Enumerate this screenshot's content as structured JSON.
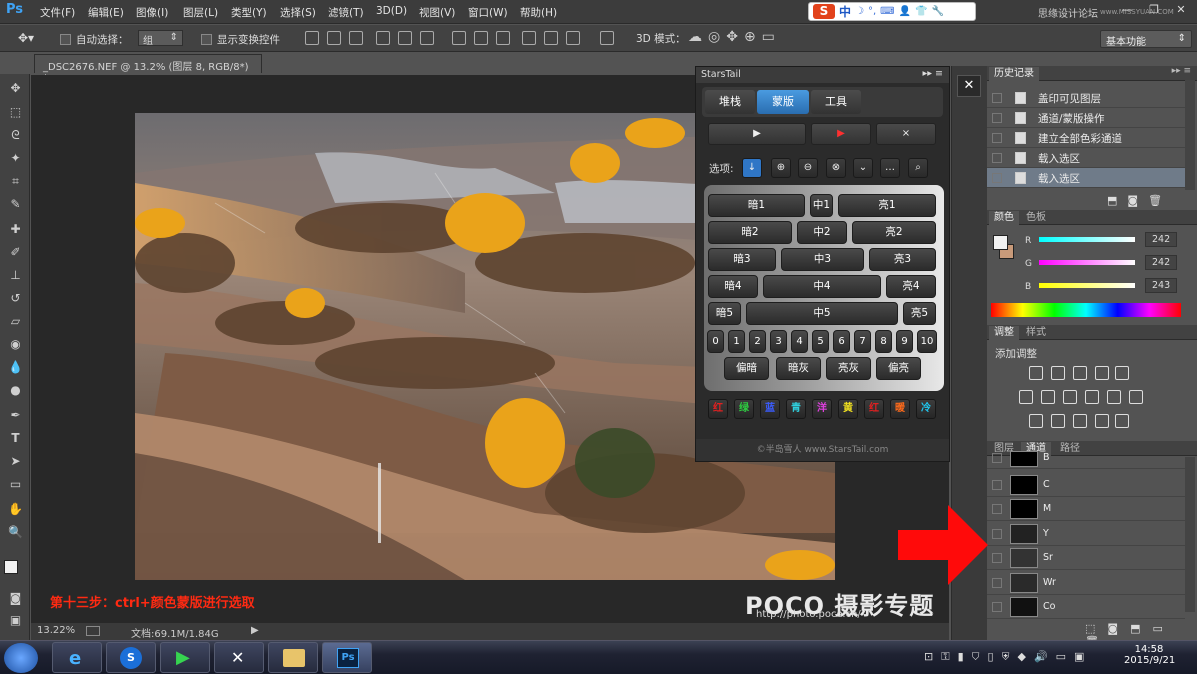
{
  "menubar": {
    "logo": "Ps",
    "items": [
      "文件(F)",
      "编辑(E)",
      "图像(I)",
      "图层(L)",
      "类型(Y)",
      "选择(S)",
      "滤镜(T)",
      "3D(D)",
      "视图(V)",
      "窗口(W)",
      "帮助(H)"
    ],
    "ime": {
      "s_icon": "S",
      "mode": "中",
      "moon": "☽",
      "punct": "°,"
    },
    "watermark": "思缘设计论坛",
    "watermark_url": "www.MISSYUAN.COM"
  },
  "options": {
    "auto_select_label": "自动选择：",
    "auto_select_value": "组",
    "show_transform_label": "显示变换控件",
    "mode_3d_label": "3D 模式：",
    "workspace": "基本功能"
  },
  "document": {
    "tab_title": "_DSC2676.NEF @ 13.2% (图层 8, RGB/8*) *",
    "step_text": "第十三步：ctrl+颜色蒙版进行选取",
    "poco_logo": "POCO 摄影专题",
    "poco_url": "http://photo.poco.cn/",
    "zoom": "13.22%",
    "doc_info": "文档:69.1M/1.84G"
  },
  "starstail": {
    "title": "StarsTail",
    "tabs": [
      "堆栈",
      "蒙版",
      "工具"
    ],
    "active_tab": "蒙版",
    "action_buttons": [
      "▶",
      "▶",
      "×"
    ],
    "options_label": "选项:",
    "rows": [
      [
        "暗1",
        "中1",
        "亮1"
      ],
      [
        "暗2",
        "中2",
        "亮2"
      ],
      [
        "暗3",
        "中3",
        "亮3"
      ],
      [
        "暗4",
        "中4",
        "亮4"
      ],
      [
        "暗5",
        "中5",
        "亮5"
      ]
    ],
    "numbers": [
      "0",
      "1",
      "2",
      "3",
      "4",
      "5",
      "6",
      "7",
      "8",
      "9",
      "10"
    ],
    "tone_buttons": [
      "偏暗",
      "暗灰",
      "亮灰",
      "偏亮"
    ],
    "colors": [
      {
        "label": "红",
        "color": "#e02020"
      },
      {
        "label": "绿",
        "color": "#2ecc40"
      },
      {
        "label": "蓝",
        "color": "#3a5cff"
      },
      {
        "label": "青",
        "color": "#2fd2e0"
      },
      {
        "label": "洋",
        "color": "#e040e0"
      },
      {
        "label": "黄",
        "color": "#f0e020"
      },
      {
        "label": "红",
        "color": "#e02020"
      },
      {
        "label": "暖",
        "color": "#ff6a1a"
      },
      {
        "label": "冷",
        "color": "#20c8f0"
      }
    ],
    "footer": "©半岛雪人 www.StarsTail.com"
  },
  "history": {
    "tab": "历史记录",
    "items": [
      "盖印可见图层",
      "通道/蒙版操作",
      "建立全部色彩通道",
      "载入选区",
      "载入选区"
    ],
    "selected_index": 4
  },
  "color_panel": {
    "tabs": [
      "颜色",
      "色板"
    ],
    "r_label": "R",
    "g_label": "G",
    "b_label": "B",
    "r": "242",
    "g": "242",
    "b": "243"
  },
  "adjust_panel": {
    "tabs": [
      "调整",
      "样式"
    ],
    "title": "添加调整"
  },
  "channels_panel": {
    "tabs": [
      "图层",
      "通道",
      "路径"
    ],
    "channels": [
      "B",
      "C",
      "M",
      "Y",
      "Sr",
      "Wr",
      "Co"
    ]
  },
  "taskbar": {
    "time": "14:58",
    "date": "2015/9/21"
  }
}
